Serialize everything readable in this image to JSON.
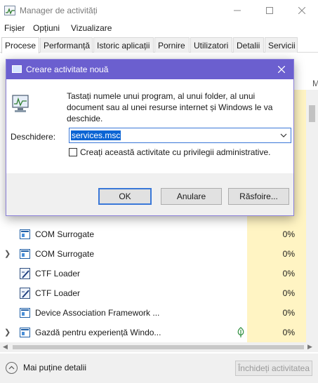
{
  "window": {
    "title": "Manager de activități"
  },
  "menu": [
    "Fișier",
    "Opțiuni",
    "Vizualizare"
  ],
  "tabs": [
    {
      "label": "Procese",
      "active": true
    },
    {
      "label": "Performanță",
      "active": false
    },
    {
      "label": "Istoric aplicații",
      "active": false
    },
    {
      "label": "Pornire",
      "active": false
    },
    {
      "label": "Utilizatori",
      "active": false
    },
    {
      "label": "Detalii",
      "active": false
    },
    {
      "label": "Servicii",
      "active": false
    }
  ],
  "table": {
    "partial_header": "M",
    "rows": [
      {
        "name": "COM Surrogate",
        "cpu": "0%",
        "icon": "window-app-icon",
        "expandable": false
      },
      {
        "name": "COM Surrogate",
        "cpu": "0%",
        "icon": "window-app-icon",
        "expandable": true
      },
      {
        "name": "CTF Loader",
        "cpu": "0%",
        "icon": "ctf-loader-icon",
        "expandable": false
      },
      {
        "name": "CTF Loader",
        "cpu": "0%",
        "icon": "ctf-loader-icon",
        "expandable": false
      },
      {
        "name": "Device Association Framework ...",
        "cpu": "0%",
        "icon": "window-app-icon",
        "expandable": false
      },
      {
        "name": "Gazdă pentru experiență Windo...",
        "cpu": "0%",
        "icon": "window-app-icon",
        "expandable": true,
        "status_icon": "leaf-icon"
      }
    ]
  },
  "footer": {
    "fewer_details": "Mai puține detalii",
    "end_task": "Închideți activitatea"
  },
  "dialog": {
    "title": "Creare activitate nouă",
    "instruction": "Tastați numele unui program, al unui folder, al unui document sau al unei resurse internet și Windows le va deschide.",
    "open_label": "Deschidere:",
    "open_value": "services.msc",
    "admin_checkbox_label": "Creați această activitate cu privilegii administrative.",
    "admin_checked": false,
    "ok": "OK",
    "cancel": "Anulare",
    "browse": "Răsfoire..."
  },
  "colors": {
    "dialog_titlebar": "#6b5fcf",
    "cpu_column": "#fff4c3",
    "selection": "#0a64d4"
  }
}
